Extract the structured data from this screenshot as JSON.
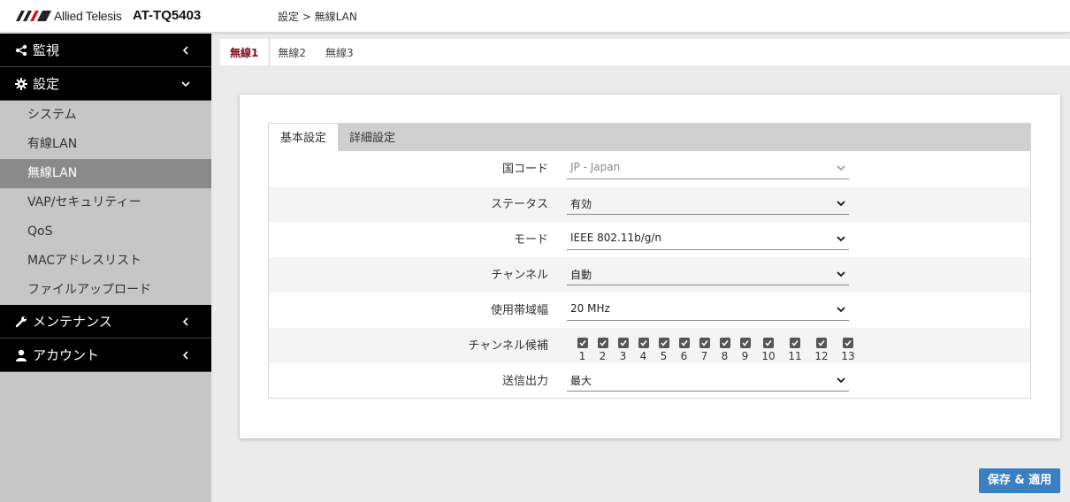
{
  "header": {
    "brand": "Allied Telesis",
    "model": "AT-TQ5403",
    "breadcrumb": "設定 > 無線LAN"
  },
  "sidebar": {
    "groups": [
      {
        "label": "監視",
        "icon": "share-icon"
      },
      {
        "label": "設定",
        "icon": "gear-icon"
      },
      {
        "label": "メンテナンス",
        "icon": "wrench-icon"
      },
      {
        "label": "アカウント",
        "icon": "user-icon"
      }
    ],
    "items": [
      {
        "label": "システム"
      },
      {
        "label": "有線LAN"
      },
      {
        "label": "無線LAN",
        "active": true
      },
      {
        "label": "VAP/セキュリティー"
      },
      {
        "label": "QoS"
      },
      {
        "label": "MACアドレスリスト"
      },
      {
        "label": "ファイルアップロード"
      }
    ]
  },
  "radio_tabs": [
    "無線1",
    "無線2",
    "無線3"
  ],
  "sub_tabs": [
    "基本設定",
    "詳細設定"
  ],
  "form": {
    "country_code": {
      "label": "国コード",
      "value": "JP - Japan"
    },
    "status": {
      "label": "ステータス",
      "value": "有効"
    },
    "mode": {
      "label": "モード",
      "value": "IEEE 802.11b/g/n"
    },
    "channel": {
      "label": "チャンネル",
      "value": "自動"
    },
    "bandwidth": {
      "label": "使用帯域幅",
      "value": "20 MHz"
    },
    "channel_candidates": {
      "label": "チャンネル候補",
      "channels": [
        "1",
        "2",
        "3",
        "4",
        "5",
        "6",
        "7",
        "8",
        "9",
        "10",
        "11",
        "12",
        "13"
      ]
    },
    "tx_power": {
      "label": "送信出力",
      "value": "最大"
    }
  },
  "save_button": "保存 & 適用",
  "colors": {
    "accent": "#7a1020",
    "button": "#3a7fc1",
    "sidebar_dark": "#000000",
    "sidebar_active": "#8a8a8a"
  }
}
